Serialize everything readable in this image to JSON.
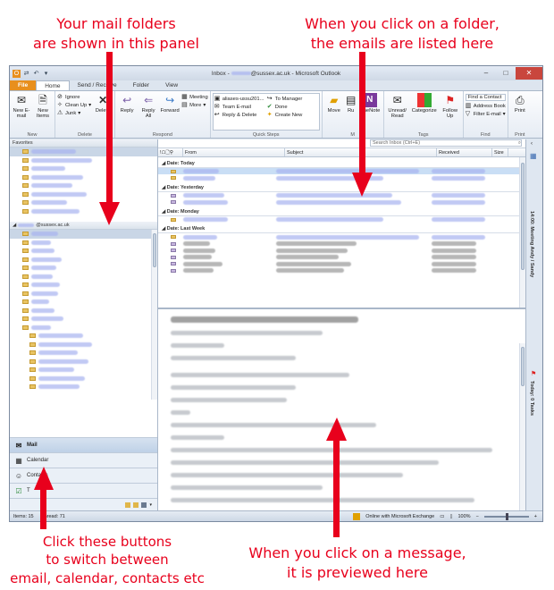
{
  "annotations": {
    "folders_line1": "Your mail folders",
    "folders_line2": "are shown in this panel",
    "list_line1": "When you click on a folder,",
    "list_line2": "the emails are listed here",
    "buttons_line1": "Click these buttons",
    "buttons_line2": "to switch between",
    "buttons_line3": "email, calendar, contacts etc",
    "preview_line1": "When you click on a message,",
    "preview_line2": "it is previewed here"
  },
  "window": {
    "title": "Inbox - ",
    "title_email": "@sussex.ac.uk",
    "title_app": " - Microsoft Outlook"
  },
  "tabs": [
    "File",
    "Home",
    "Send / Receive",
    "Folder",
    "View"
  ],
  "ribbon": {
    "new": {
      "new_email": "New E-mail",
      "new_items": "New Items",
      "label": "New"
    },
    "delete": {
      "ignore": "Ignore",
      "clean_up": "Clean Up",
      "junk": "Junk",
      "delete": "Delete",
      "label": "Delete"
    },
    "respond": {
      "reply": "Reply",
      "reply_all": "Reply All",
      "forward": "Forward",
      "meeting": "Meeting",
      "more": "More",
      "label": "Respond"
    },
    "quick_steps": {
      "item1": "aliases-ussu201...",
      "item2": "Team E-mail",
      "item3": "Reply & Delete",
      "item4": "To Manager",
      "item5": "Done",
      "item6": "Create New",
      "label": "Quick Steps"
    },
    "move": {
      "move": "Move",
      "rules": "Ru",
      "onenote": "OneNote",
      "label": "M"
    },
    "tags": {
      "unread_read": "Unread/ Read",
      "categorize": "Categorize",
      "follow_up": "Follow Up",
      "label": "Tags"
    },
    "find": {
      "find_contact": "Find a Contact",
      "address_book": "Address Book",
      "filter_email": "Filter E-mail",
      "label": "Find"
    },
    "print": {
      "print": "Print",
      "label": "Print"
    }
  },
  "nav": {
    "favorites": "Favorites",
    "account": "@sussex.ac.uk",
    "buttons": [
      "Mail",
      "Calendar",
      "Contacts",
      "T"
    ]
  },
  "list": {
    "search_placeholder": "Search Inbox (Ctrl+E)",
    "columns": [
      "From",
      "Subject",
      "Received",
      "Size"
    ],
    "groups": [
      "Date: Today",
      "Date: Yesterday",
      "Date: Monday",
      "Date: Last Week"
    ]
  },
  "todo": {
    "meeting": "14:00: Meeting Andy / Sandy",
    "tasks": "Today: 0 Tasks"
  },
  "status": {
    "items": "Items: 15",
    "unread": "Unread: 71",
    "exchange": "Online with Microsoft Exchange",
    "zoom": "100%"
  }
}
